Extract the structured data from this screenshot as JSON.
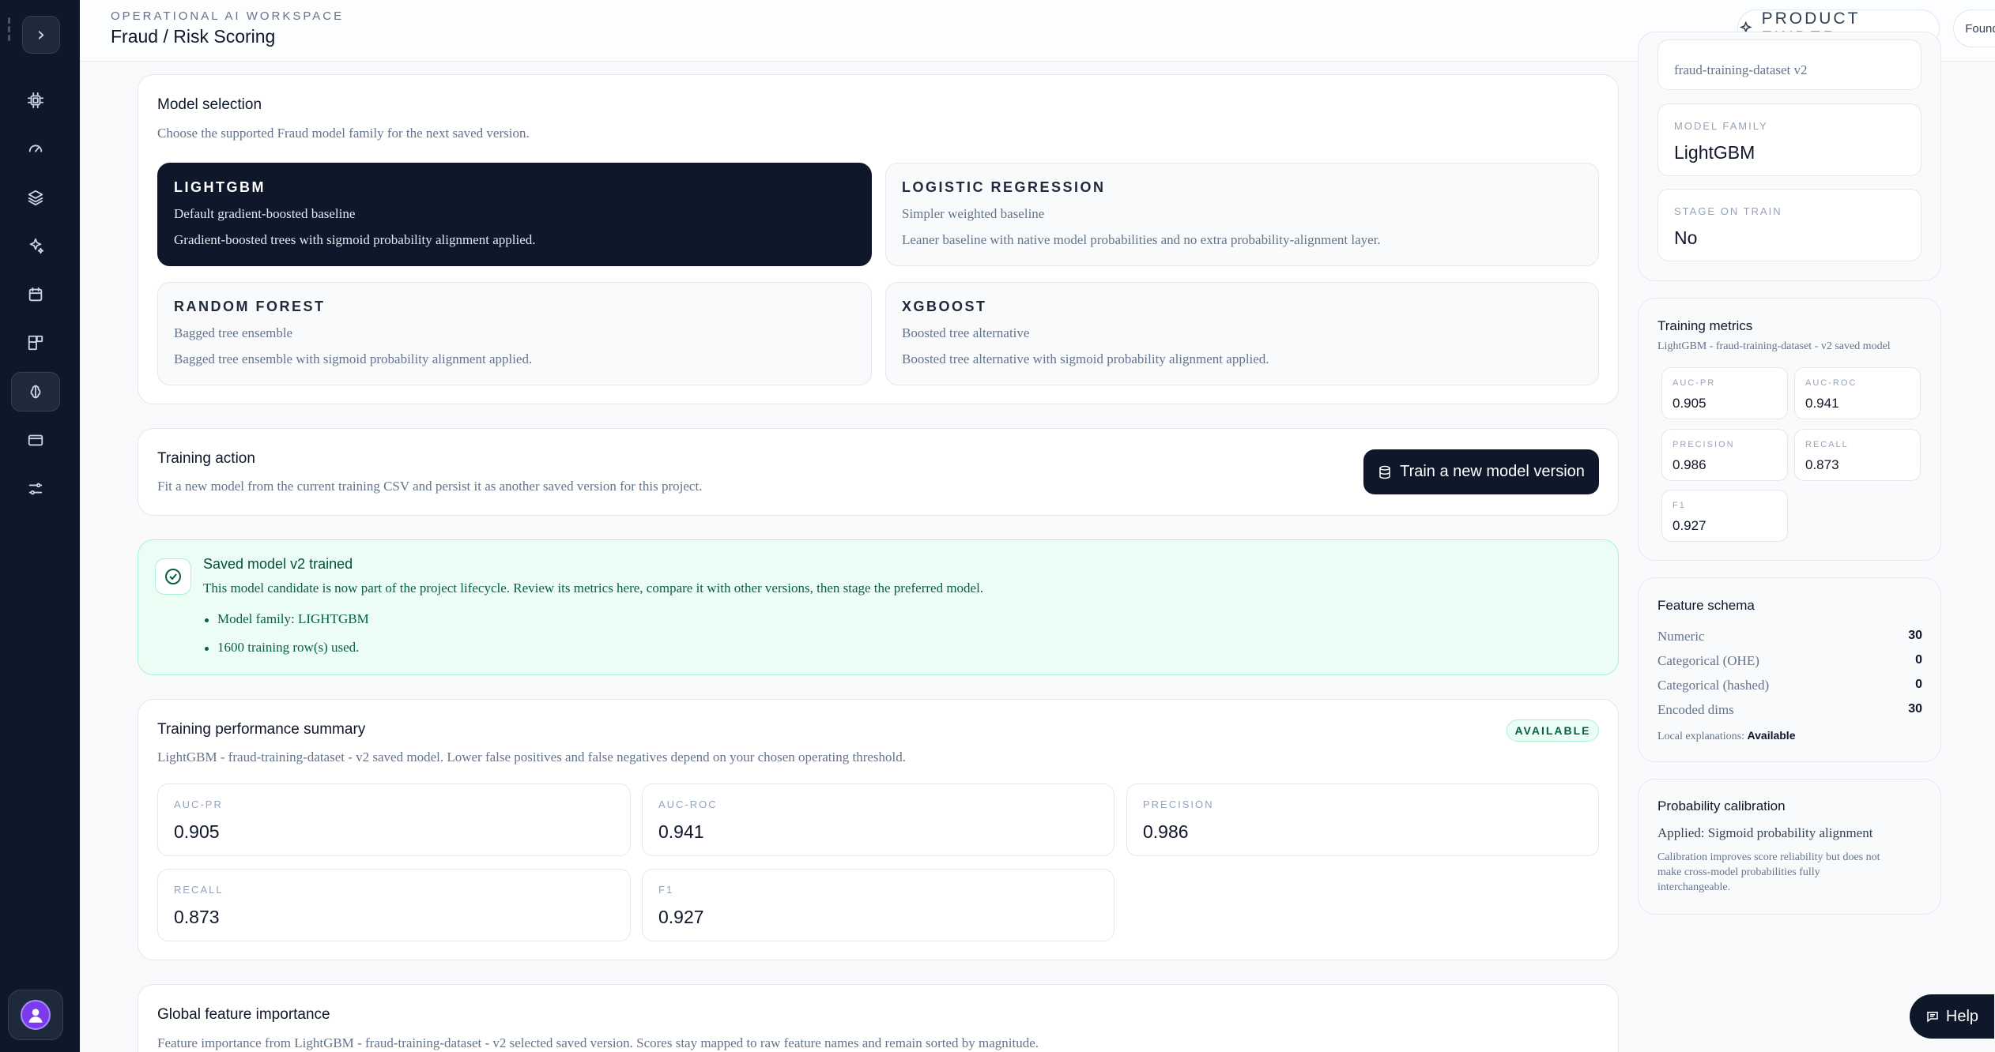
{
  "header": {
    "eyebrow": "OPERATIONAL AI WORKSPACE",
    "title": "Fraud / Risk Scoring",
    "product_finder_label": "PRODUCT FINDER",
    "account_label": "Founder account"
  },
  "rail": {
    "icons": [
      "chip-icon",
      "gauge-icon",
      "layers-icon",
      "sparkle-icon",
      "calendar-icon",
      "blocks-icon",
      "brain-icon",
      "card-icon",
      "sliders-icon"
    ],
    "active_index": 6
  },
  "model_selection": {
    "title": "Model selection",
    "subtitle": "Choose the supported Fraud model family for the next saved version.",
    "options": [
      {
        "name": "LIGHTGBM",
        "tag": "Default gradient-boosted baseline",
        "desc": "Gradient-boosted trees with sigmoid probability alignment applied.",
        "selected": true
      },
      {
        "name": "LOGISTIC REGRESSION",
        "tag": "Simpler weighted baseline",
        "desc": "Leaner baseline with native model probabilities and no extra probability-alignment layer.",
        "selected": false
      },
      {
        "name": "RANDOM FOREST",
        "tag": "Bagged tree ensemble",
        "desc": "Bagged tree ensemble with sigmoid probability alignment applied.",
        "selected": false
      },
      {
        "name": "XGBOOST",
        "tag": "Boosted tree alternative",
        "desc": "Boosted tree alternative with sigmoid probability alignment applied.",
        "selected": false
      }
    ]
  },
  "training_action": {
    "title": "Training action",
    "subtitle": "Fit a new model from the current training CSV and persist it as another saved version for this project.",
    "button_label": "Train a new model version"
  },
  "success": {
    "title": "Saved model v2 trained",
    "description": "This model candidate is now part of the project lifecycle. Review its metrics here, compare it with other versions, then stage the preferred model.",
    "bullets": [
      "Model family: LIGHTGBM",
      "1600 training row(s) used."
    ]
  },
  "performance": {
    "title": "Training performance summary",
    "subtitle": "LightGBM - fraud-training-dataset - v2 saved model. Lower false positives and false negatives depend on your chosen operating threshold.",
    "badge": "AVAILABLE",
    "metrics": [
      {
        "label": "AUC-PR",
        "value": "0.905"
      },
      {
        "label": "AUC-ROC",
        "value": "0.941"
      },
      {
        "label": "PRECISION",
        "value": "0.986"
      },
      {
        "label": "RECALL",
        "value": "0.873"
      },
      {
        "label": "F1",
        "value": "0.927"
      }
    ]
  },
  "feature_importance": {
    "title": "Global feature importance",
    "subtitle": "Feature importance from LightGBM - fraud-training-dataset - v2 selected saved version. Scores stay mapped to raw feature names and remain sorted by magnitude."
  },
  "summary": {
    "dataset_value": "fraud-training-dataset v2",
    "model_family_label": "MODEL FAMILY",
    "model_family_value": "LightGBM",
    "stage_label": "STAGE ON TRAIN",
    "stage_value": "No"
  },
  "training_metrics": {
    "title": "Training metrics",
    "subtitle": "LightGBM - fraud-training-dataset - v2 saved model",
    "metrics": [
      {
        "label": "AUC-PR",
        "value": "0.905"
      },
      {
        "label": "AUC-ROC",
        "value": "0.941"
      },
      {
        "label": "PRECISION",
        "value": "0.986"
      },
      {
        "label": "RECALL",
        "value": "0.873"
      },
      {
        "label": "F1",
        "value": "0.927"
      }
    ]
  },
  "feature_schema": {
    "title": "Feature schema",
    "rows": [
      {
        "label": "Numeric",
        "value": "30"
      },
      {
        "label": "Categorical (OHE)",
        "value": "0"
      },
      {
        "label": "Categorical (hashed)",
        "value": "0"
      },
      {
        "label": "Encoded dims",
        "value": "30"
      }
    ],
    "explanations_label": "Local explanations:",
    "explanations_value": "Available"
  },
  "calibration": {
    "title": "Probability calibration",
    "applied": "Applied: Sigmoid probability alignment",
    "note_line1": "Calibration improves score reliability but does not",
    "note_line2": "make cross-model probabilities fully",
    "note_line3": "interchangeable."
  },
  "help_label": "Help",
  "colors": {
    "primary": "#0f172a",
    "success_bg": "#ecfdf5",
    "success_text": "#065f46",
    "accent": "#7c3aed"
  }
}
